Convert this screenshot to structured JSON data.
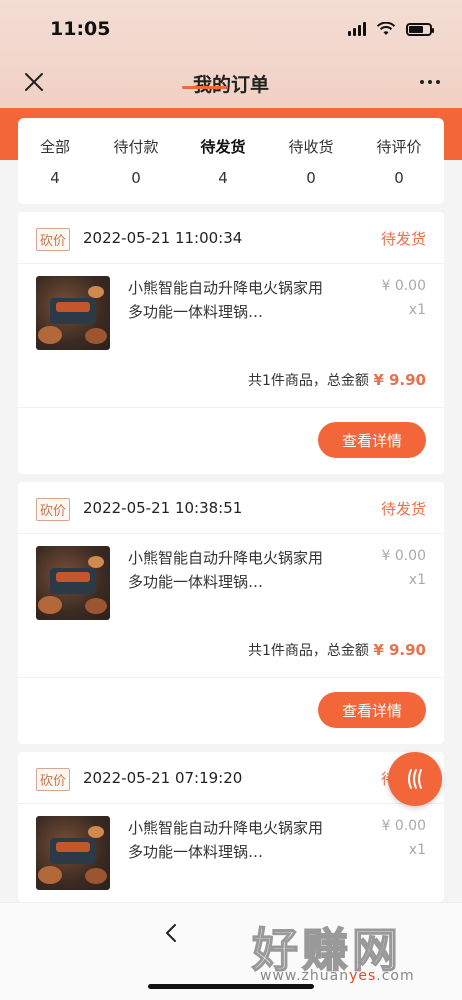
{
  "status_bar": {
    "time": "11:05"
  },
  "navbar": {
    "title": "我的订单"
  },
  "tabs": [
    {
      "label": "全部",
      "count": "4"
    },
    {
      "label": "待付款",
      "count": "0"
    },
    {
      "label": "待发货",
      "count": "4",
      "active": true
    },
    {
      "label": "待收货",
      "count": "0"
    },
    {
      "label": "待评价",
      "count": "0"
    }
  ],
  "orders": [
    {
      "tag": "砍价",
      "datetime": "2022-05-21 11:00:34",
      "status": "待发货",
      "product_title": "小熊智能自动升降电火锅家用多功能一体料理锅…",
      "price": "¥ 0.00",
      "qty": "x1",
      "summary_prefix": "共1件商品，总金额",
      "total": "¥ 9.90",
      "button": "查看详情"
    },
    {
      "tag": "砍价",
      "datetime": "2022-05-21 10:38:51",
      "status": "待发货",
      "product_title": "小熊智能自动升降电火锅家用多功能一体料理锅…",
      "price": "¥ 0.00",
      "qty": "x1",
      "summary_prefix": "共1件商品，总金额",
      "total": "¥ 9.90",
      "button": "查看详情"
    },
    {
      "tag": "砍价",
      "datetime": "2022-05-21 07:19:20",
      "status": "待",
      "product_title": "小熊智能自动升降电火锅家用多功能一体料理锅…",
      "price": "¥ 0.00",
      "qty": "x1"
    }
  ],
  "watermark": {
    "text": "好赚网",
    "url_pre": "www.zhuan",
    "url_hl": "yes",
    "url_post": ".com"
  },
  "colors": {
    "accent": "#f2663a",
    "status": "#e8704a",
    "tag_border": "#d9a58c"
  }
}
